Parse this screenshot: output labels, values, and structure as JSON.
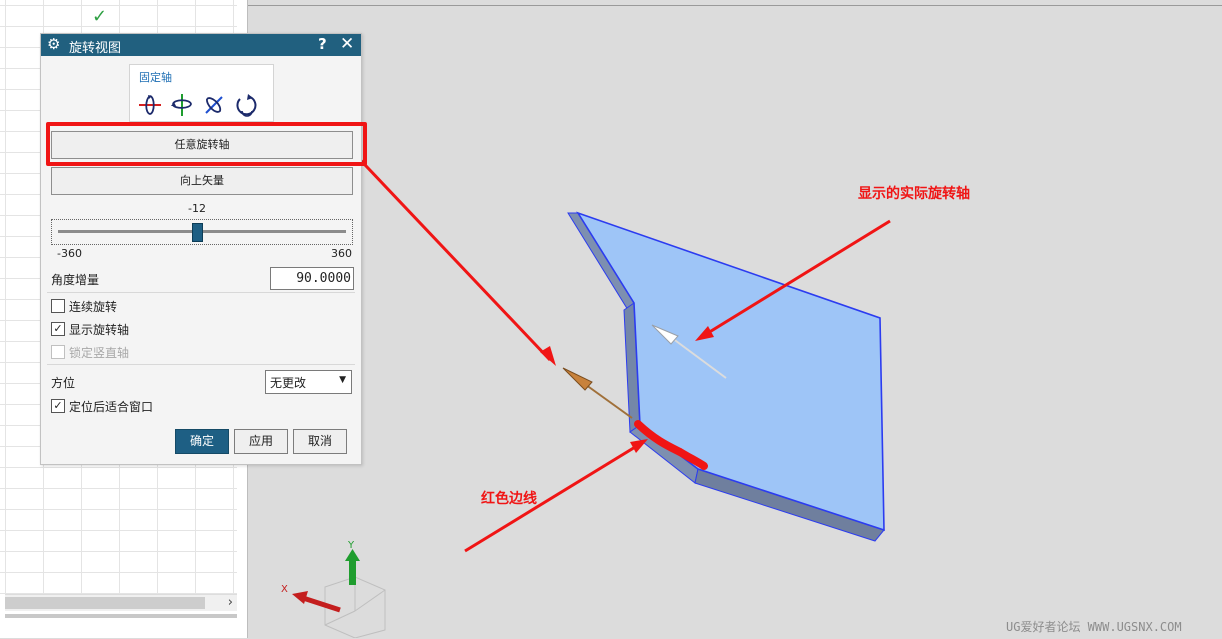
{
  "dialog": {
    "title": "旋转视图",
    "help_icon": "question-icon",
    "close_icon": "close-icon",
    "fixed_axis_label": "固定轴",
    "fixed_axis_icons": [
      "rotate-x-axis-icon",
      "rotate-y-axis-icon",
      "rotate-z-axis-icon",
      "rotate-free-icon"
    ],
    "arbitrary_axis_button": "任意旋转轴",
    "up_vector_button": "向上矢量",
    "slider": {
      "value": "-12",
      "min_label": "-360",
      "max_label": "360",
      "min": -360,
      "max": 360,
      "current": -12
    },
    "angle_increment_label": "角度增量",
    "angle_increment_value": "90.0000",
    "checkboxes": [
      {
        "label": "连续旋转",
        "checked": false,
        "enabled": true
      },
      {
        "label": "显示旋转轴",
        "checked": true,
        "enabled": true
      },
      {
        "label": "锁定竖直轴",
        "checked": false,
        "enabled": false
      }
    ],
    "orientation_label": "方位",
    "orientation_value": "无更改",
    "fit_after_orient": {
      "label": "定位后适合窗口",
      "checked": true
    },
    "buttons": {
      "ok": "确定",
      "apply": "应用",
      "cancel": "取消"
    }
  },
  "annotations": {
    "actual_axis": "显示的实际旋转轴",
    "red_edge": "红色边线"
  },
  "triad": {
    "x_label": "X",
    "y_label": "Y"
  },
  "watermark": "UG爱好者论坛 WWW.UGSNX.COM",
  "colors": {
    "titlebar": "#21607f",
    "accent": "#1e5f84",
    "annotation_red": "#f01515",
    "part_face": "#9ec5f7",
    "part_edge": "#2c3cf0",
    "part_side": "#7d8fb0",
    "check_green": "#2ea043"
  }
}
